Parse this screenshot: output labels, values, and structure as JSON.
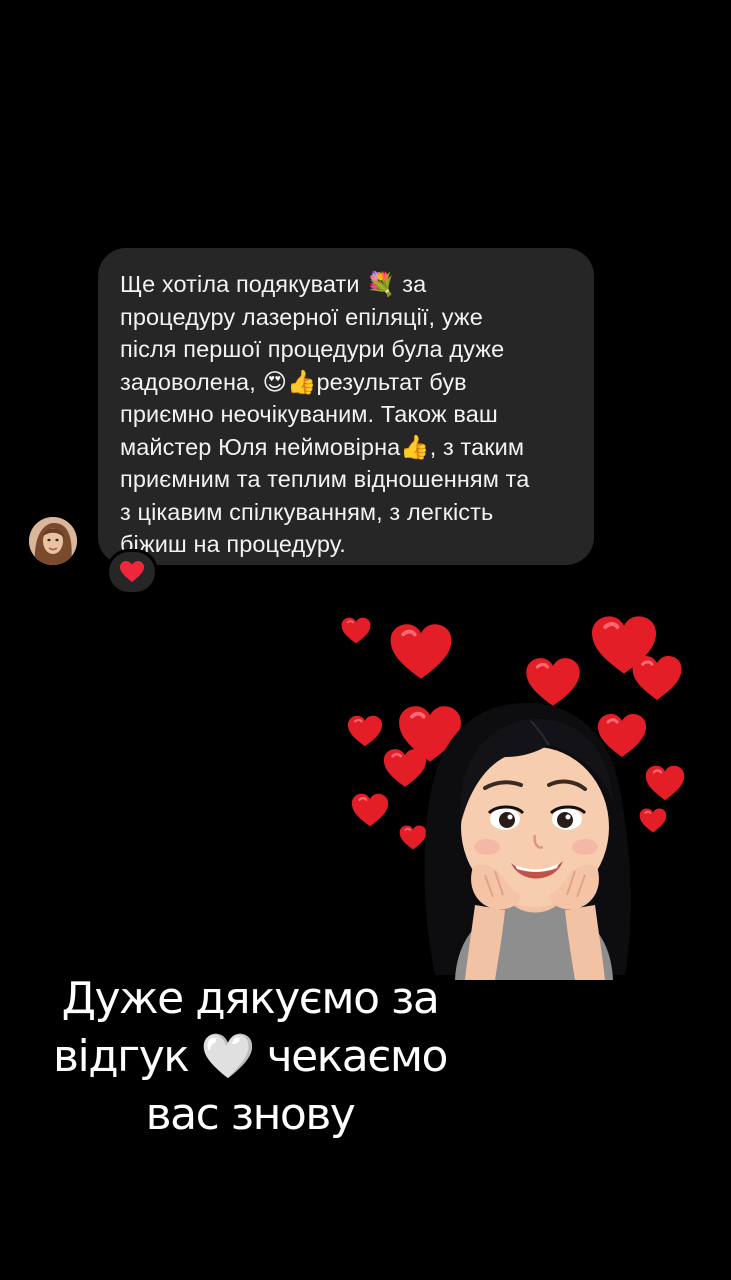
{
  "message": {
    "lines": [
      "Ще хотіла подякувати 💐 за",
      "процедуру лазерної епіляції,  уже",
      "після першої процедури була дуже",
      "задоволена, 😍👍результат був",
      "приємно неочікуваним. Також ваш",
      "майстер Юля неймовірна👍, з таким",
      "приємним та теплим  відношенням та",
      "з цікавим  спілкуванням, з легкість",
      "біжиш на процедуру."
    ],
    "reaction": "heart",
    "bubble_color": "#262626"
  },
  "sticker": {
    "description_icon": "girl-with-hearts-sticker",
    "heart_color": "#e8232d"
  },
  "caption": {
    "line1": "Дуже дякуємо за",
    "line2": "відгук 🤍 чекаємо",
    "line3": "вас знову"
  }
}
